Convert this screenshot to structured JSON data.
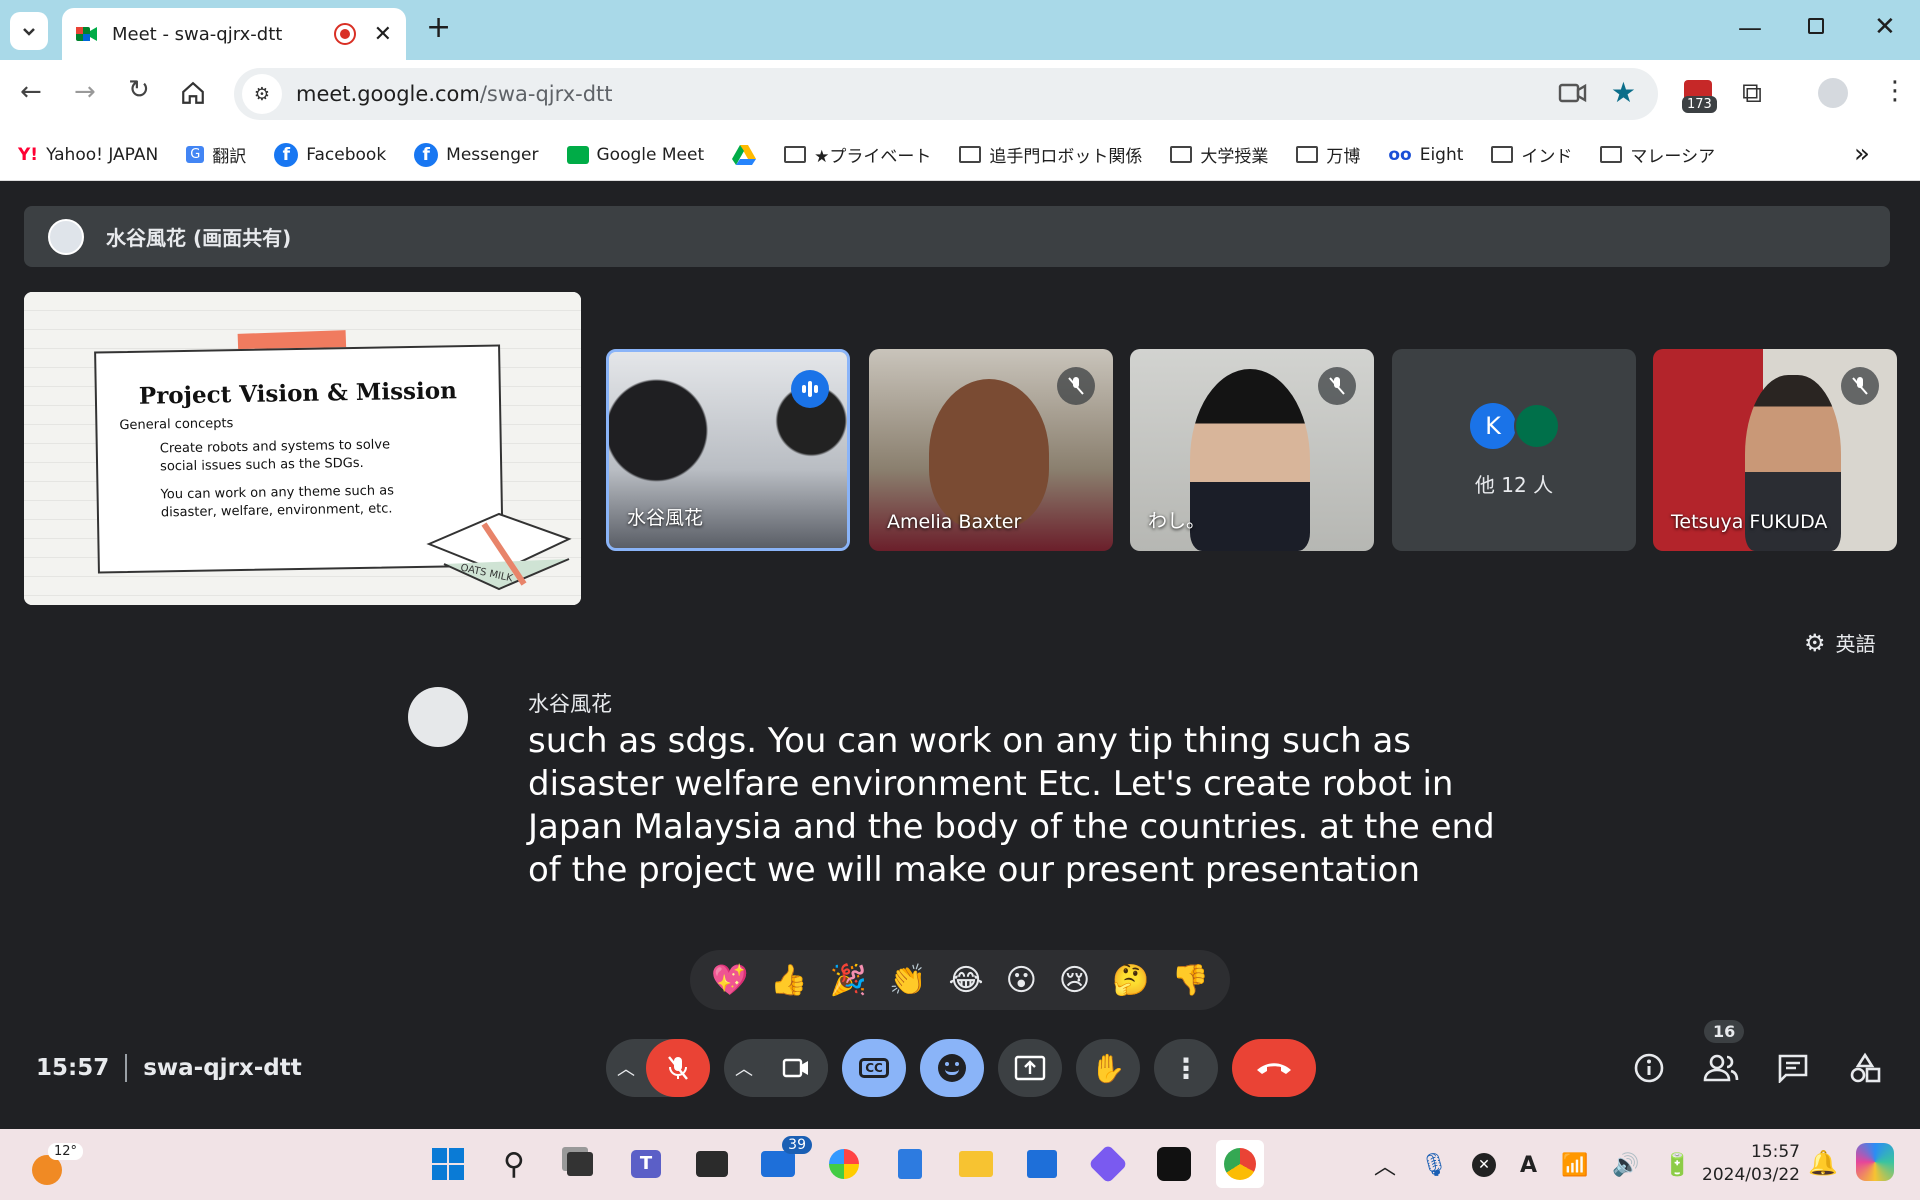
{
  "browser": {
    "tab_title": "Meet - swa-qjrx-dtt",
    "new_tab": "+",
    "url_domain": "meet.google.com",
    "url_path": "/swa-qjrx-dtt",
    "extension_badge": "173"
  },
  "bookmarks": [
    {
      "label": "Yahoo! JAPAN",
      "icon": "yahoo-icon"
    },
    {
      "label": "翻訳",
      "icon": "translate-icon"
    },
    {
      "label": "Facebook",
      "icon": "facebook-icon"
    },
    {
      "label": "Messenger",
      "icon": "messenger-icon"
    },
    {
      "label": "Google Meet",
      "icon": "meet-icon"
    },
    {
      "label": "",
      "icon": "drive-icon"
    },
    {
      "label": "★プライベート",
      "icon": "folder-icon"
    },
    {
      "label": "追手門ロボット関係",
      "icon": "folder-icon"
    },
    {
      "label": "大学授業",
      "icon": "folder-icon"
    },
    {
      "label": "万博",
      "icon": "folder-icon"
    },
    {
      "label": "Eight",
      "icon": "eight-icon"
    },
    {
      "label": "インド",
      "icon": "folder-icon"
    },
    {
      "label": "マレーシア",
      "icon": "folder-icon"
    }
  ],
  "meet": {
    "presenter_banner": "水谷風花 (画面共有)",
    "slide": {
      "title": "Project Vision & Mission",
      "subtitle": "General concepts",
      "bullet1": "Create robots and systems to solve social issues such as the SDGs.",
      "bullet2": "You can work on any theme such as disaster, welfare, environment, etc.",
      "book_label": "OATS MILK"
    },
    "tiles": [
      {
        "name": "水谷風花",
        "state": "speaking"
      },
      {
        "name": "Amelia Baxter",
        "state": "muted"
      },
      {
        "name": "わし。",
        "state": "muted"
      },
      {
        "name": "他 12 人",
        "state": "others",
        "avatar_letter": "K"
      },
      {
        "name": "Tetsuya FUKUDA",
        "state": "muted"
      }
    ],
    "caption_language": "英語",
    "caption_speaker": "水谷風花",
    "caption_text": "such as sdgs. You can work on any tip thing such as disaster welfare environment Etc. Let's create robot in Japan Malaysia and the body of the countries. at the end of the project we will make our present presentation",
    "reactions": [
      "💖",
      "👍",
      "🎉",
      "👏",
      "😂",
      "😮",
      "😢",
      "🤔",
      "👎"
    ],
    "time": "15:57",
    "meeting_code": "swa-qjrx-dtt",
    "participant_count": "16"
  },
  "taskbar": {
    "weather": "12°",
    "mail_badge": "39",
    "clock_time": "15:57",
    "clock_date": "2024/03/22"
  },
  "colors": {
    "meet_bg": "#202124",
    "speaking_border": "#8ab4f8",
    "end_call": "#ea4335",
    "tab_strip": "#a9d9e8"
  }
}
